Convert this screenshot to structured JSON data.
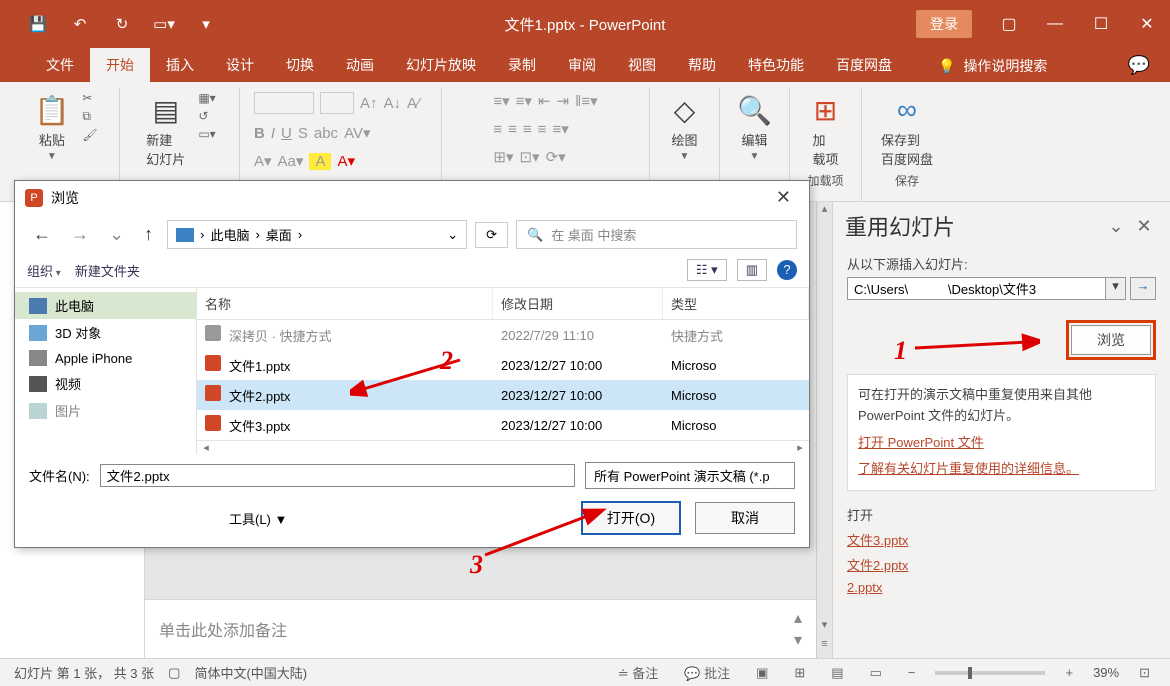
{
  "titlebar": {
    "title": "文件1.pptx - PowerPoint",
    "login": "登录"
  },
  "tabs": {
    "file": "文件",
    "home": "开始",
    "insert": "插入",
    "design": "设计",
    "transition": "切换",
    "animation": "动画",
    "slideshow": "幻灯片放映",
    "record": "录制",
    "review": "审阅",
    "view": "视图",
    "help": "帮助",
    "special": "特色功能",
    "baidudisk": "百度网盘",
    "tellme": "操作说明搜索"
  },
  "ribbon": {
    "clipboard": {
      "paste": "粘贴"
    },
    "slides": {
      "new": "新建\n幻灯片"
    },
    "drawing": {
      "draw": "绘图"
    },
    "editing": {
      "edit": "编辑"
    },
    "addins": {
      "add": "加\n载项",
      "group": "加载项"
    },
    "save": {
      "btn": "保存到\n百度网盘",
      "group": "保存"
    }
  },
  "dialog": {
    "title": "浏览",
    "crumb_pc": "此电脑",
    "crumb_desktop": "桌面",
    "search_placeholder": "在 桌面 中搜索",
    "organize": "组织",
    "newfolder": "新建文件夹",
    "tree": {
      "thispc": "此电脑",
      "objects3d": "3D 对象",
      "iphone": "Apple iPhone",
      "video": "视频",
      "pic": "图片"
    },
    "cols": {
      "name": "名称",
      "date": "修改日期",
      "type": "类型"
    },
    "rows": [
      {
        "name": "文件1.pptx",
        "date": "2023/12/27 10:00",
        "type": "Microso"
      },
      {
        "name": "文件2.pptx",
        "date": "2023/12/27 10:00",
        "type": "Microso"
      },
      {
        "name": "文件3.pptx",
        "date": "2023/12/27 10:00",
        "type": "Microso"
      }
    ],
    "dim_row": {
      "name": "···",
      "date": "2022/7/29 11:10",
      "type": "快捷方式"
    },
    "filename_label": "文件名(N):",
    "filename_value": "文件2.pptx",
    "filter": "所有 PowerPoint 演示文稿 (*.p",
    "tools": "工具(L)",
    "open": "打开(O)",
    "cancel": "取消"
  },
  "reuse": {
    "title": "重用幻灯片",
    "from_label": "从以下源插入幻灯片:",
    "path": "C:\\Users\\           \\Desktop\\文件3",
    "browse": "浏览",
    "info": "可在打开的演示文稿中重复使用来自其他 PowerPoint 文件的幻灯片。",
    "link_open": "打开 PowerPoint 文件",
    "link_learn": "了解有关幻灯片重复使用的详细信息。",
    "recent_label": "打开",
    "recent": [
      "文件3.pptx",
      "文件2.pptx",
      "2.pptx"
    ]
  },
  "notes": {
    "placeholder": "单击此处添加备注"
  },
  "status": {
    "slide": "幻灯片 第 1 张， 共 3 张",
    "lang": "简体中文(中国大陆)",
    "notes": "备注",
    "comments": "批注",
    "zoom": "39%"
  },
  "anno": {
    "n1": "1",
    "n2": "2",
    "n3": "3"
  }
}
